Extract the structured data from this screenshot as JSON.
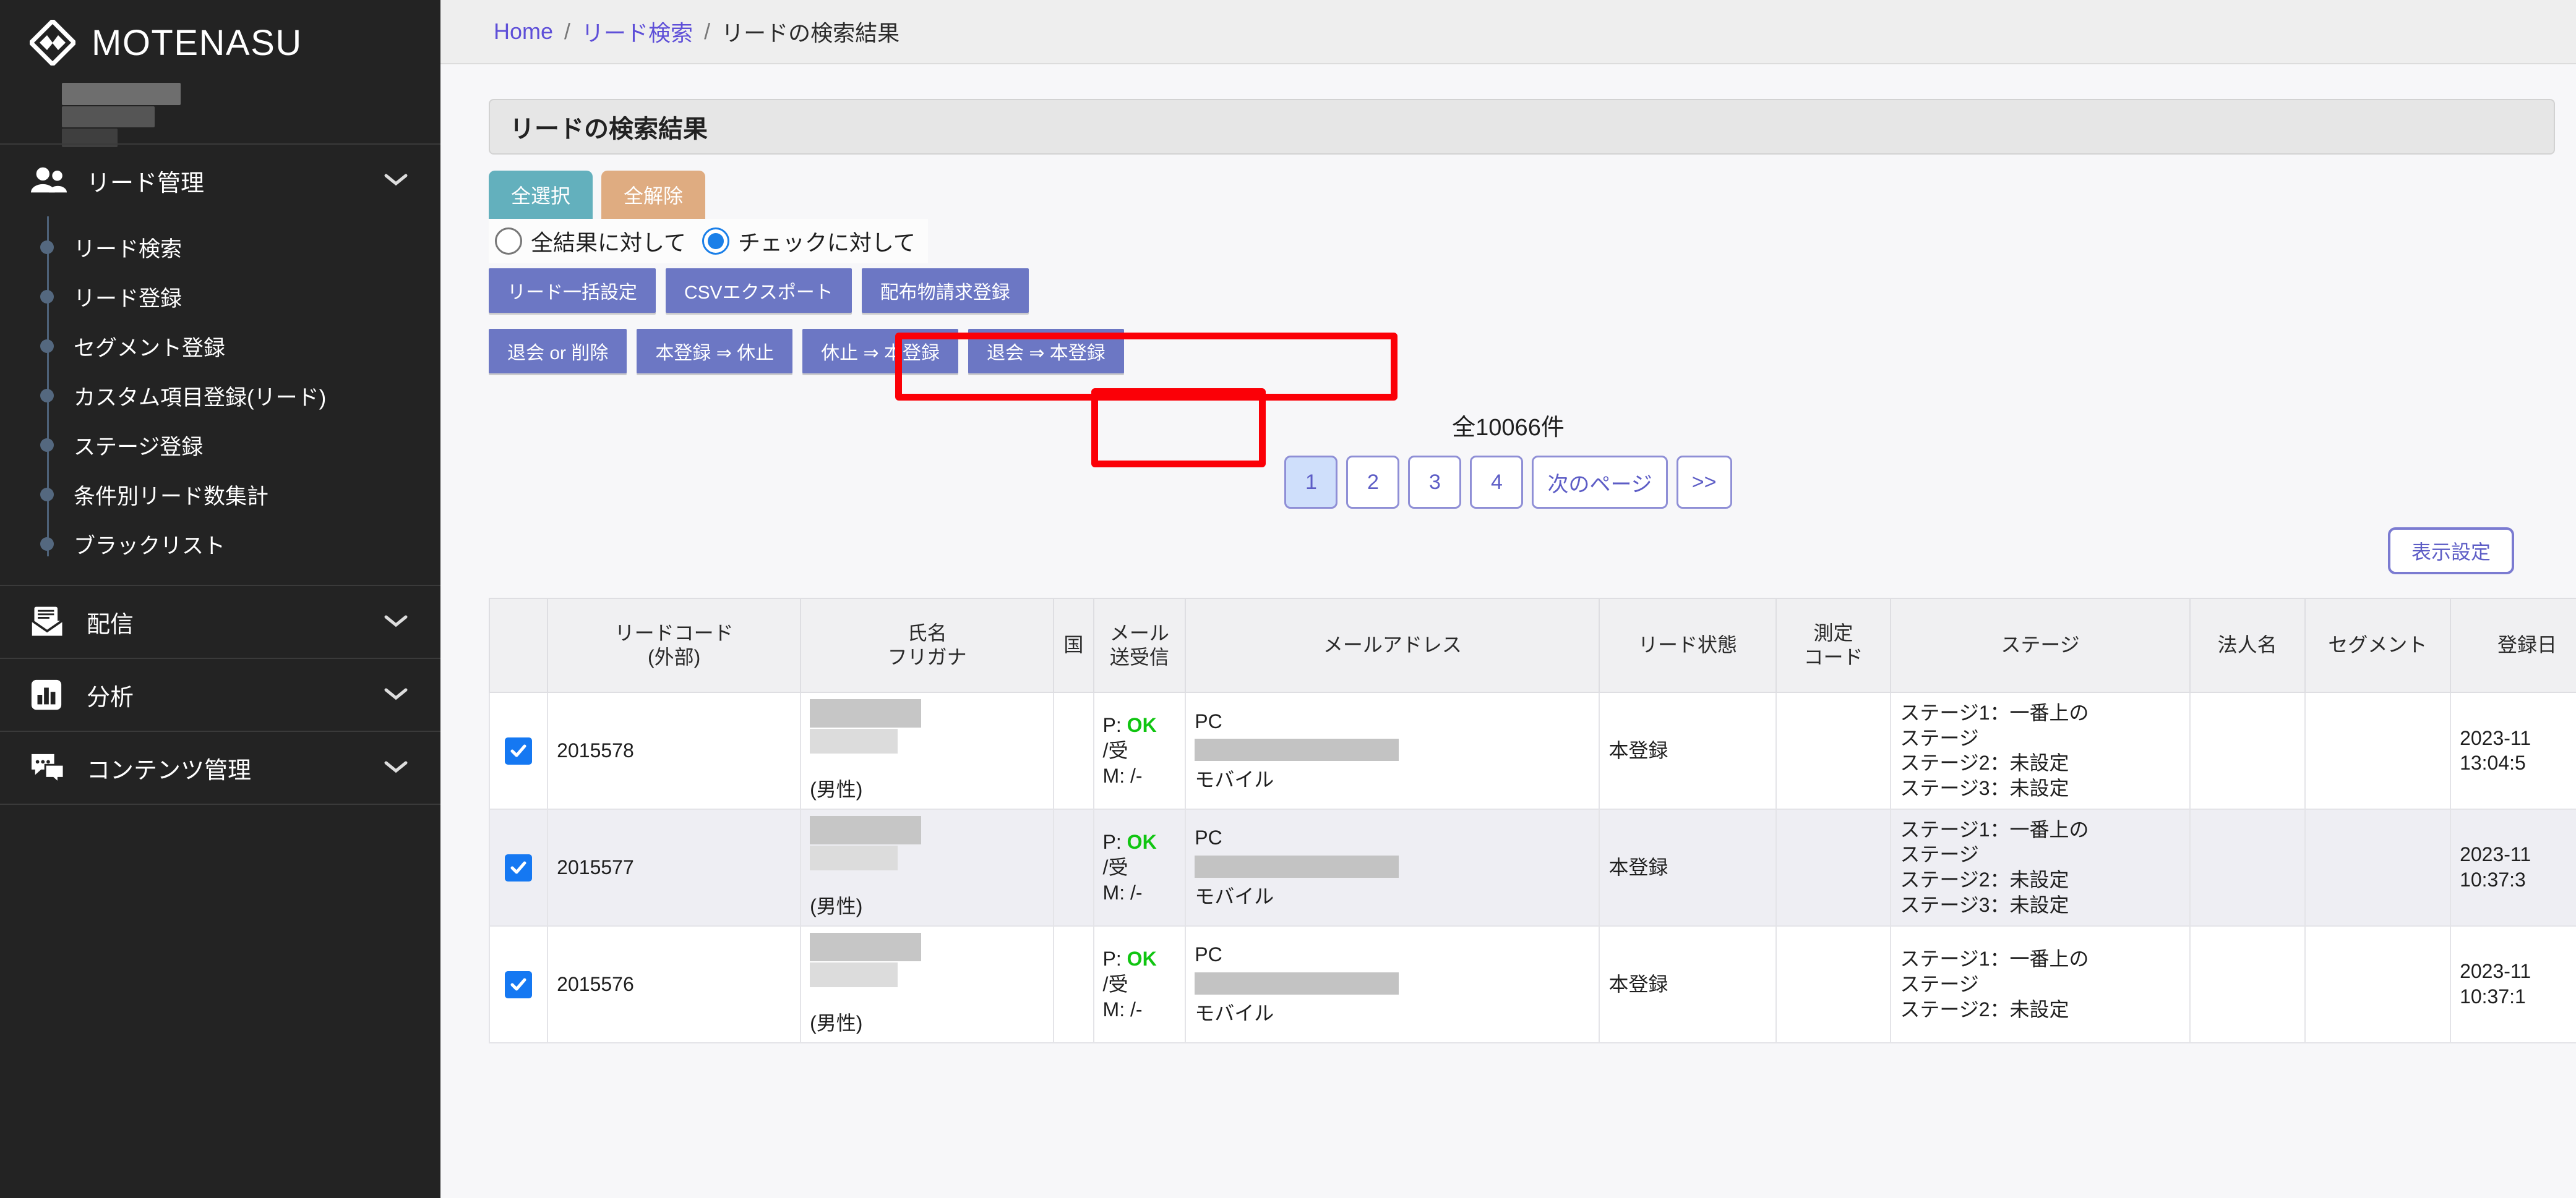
{
  "brand": {
    "name": "MOTENASU"
  },
  "sidebar": {
    "groups": [
      {
        "label": "リード管理",
        "icon": "users-icon",
        "items": [
          {
            "label": "リード検索"
          },
          {
            "label": "リード登録"
          },
          {
            "label": "セグメント登録"
          },
          {
            "label": "カスタム項目登録(リード)"
          },
          {
            "label": "ステージ登録"
          },
          {
            "label": "条件別リード数集計"
          },
          {
            "label": "ブラックリスト"
          }
        ]
      },
      {
        "label": "配信",
        "icon": "mail-icon",
        "items": []
      },
      {
        "label": "分析",
        "icon": "chart-icon",
        "items": []
      },
      {
        "label": "コンテンツ管理",
        "icon": "chat-icon",
        "items": []
      }
    ]
  },
  "breadcrumb": {
    "home": "Home",
    "sep": "/",
    "parent": "リード検索",
    "current": "リードの検索結果"
  },
  "page": {
    "title": "リードの検索結果"
  },
  "tabs": {
    "select_all": "全選択",
    "clear_all": "全解除"
  },
  "scope": {
    "all_results": "全結果に対して",
    "checked": "チェックに対して",
    "selected": "checked"
  },
  "actions_row1": [
    {
      "label": "リード一括設定"
    },
    {
      "label": "CSVエクスポート"
    },
    {
      "label": "配布物請求登録"
    }
  ],
  "actions_row2": [
    {
      "label": "退会 or 削除"
    },
    {
      "label": "本登録 ⇒ 休止"
    },
    {
      "label": "休止 ⇒ 本登録"
    },
    {
      "label": "退会 ⇒ 本登録"
    }
  ],
  "result": {
    "count_text": "全10066件"
  },
  "pager": {
    "pages": [
      "1",
      "2",
      "3",
      "4"
    ],
    "active": "1",
    "next_label": "次のページ",
    "last_label": ">>"
  },
  "display_setting": {
    "label": "表示設定"
  },
  "table": {
    "columns": [
      {
        "key": "check",
        "label": ""
      },
      {
        "key": "code",
        "label": "リードコード",
        "sub": "(外部)"
      },
      {
        "key": "name",
        "label": "氏名",
        "sub": "フリガナ"
      },
      {
        "key": "kuni",
        "label": "国"
      },
      {
        "key": "mail",
        "label": "メール",
        "sub": "送受信"
      },
      {
        "key": "addr",
        "label": "メールアドレス"
      },
      {
        "key": "state",
        "label": "リード状態"
      },
      {
        "key": "meas",
        "label": "測定",
        "sub": "コード"
      },
      {
        "key": "stage",
        "label": "ステージ"
      },
      {
        "key": "corp",
        "label": "法人名"
      },
      {
        "key": "seg",
        "label": "セグメント"
      },
      {
        "key": "date",
        "label": "登録日"
      }
    ],
    "rows": [
      {
        "checked": true,
        "code": "2015578",
        "name_masked": true,
        "gender": "(男性)",
        "kuni": "",
        "mail_p": "P:",
        "mail_p_status": "OK",
        "mail_recv": "/受",
        "mail_m": "M: /-",
        "addr_pc": "PC",
        "addr_mobile": "モバイル",
        "state": "本登録",
        "meas": "",
        "stage1": "ステージ1：一番上の",
        "stage1b": "ステージ",
        "stage2": "ステージ2：未設定",
        "stage3": "ステージ3：未設定",
        "corp": "",
        "seg": "",
        "date_d": "2023-11",
        "date_t": "13:04:5"
      },
      {
        "checked": true,
        "code": "2015577",
        "name_masked": true,
        "gender": "(男性)",
        "kuni": "",
        "mail_p": "P:",
        "mail_p_status": "OK",
        "mail_recv": "/受",
        "mail_m": "M: /-",
        "addr_pc": "PC",
        "addr_mobile": "モバイル",
        "state": "本登録",
        "meas": "",
        "stage1": "ステージ1：一番上の",
        "stage1b": "ステージ",
        "stage2": "ステージ2：未設定",
        "stage3": "ステージ3：未設定",
        "corp": "",
        "seg": "",
        "date_d": "2023-11",
        "date_t": "10:37:3"
      },
      {
        "checked": true,
        "code": "2015576",
        "name_masked": true,
        "gender": "(男性)",
        "kuni": "",
        "mail_p": "P:",
        "mail_p_status": "OK",
        "mail_recv": "/受",
        "mail_m": "M: /-",
        "addr_pc": "PC",
        "addr_mobile": "モバイル",
        "state": "本登録",
        "meas": "",
        "stage1": "ステージ1：一番上の",
        "stage1b": "ステージ",
        "stage2": "ステージ2：未設定",
        "stage3": "",
        "corp": "",
        "seg": "",
        "date_d": "2023-11",
        "date_t": "10:37:1"
      }
    ]
  },
  "colors": {
    "sidebar_bg": "#232323",
    "accent_purple": "#6c77c4",
    "tab_select": "#63b0bd",
    "tab_clear": "#dfac81",
    "annotation_red": "#fb0007",
    "status_ok_green": "#10c511",
    "link_purple": "#5e4fd8"
  }
}
